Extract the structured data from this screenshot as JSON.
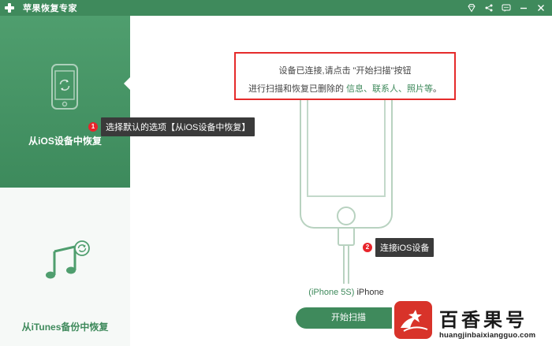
{
  "app": {
    "title": "苹果恢复专家"
  },
  "titlebar_icons": [
    "diamond-icon",
    "share-icon",
    "chat-icon",
    "minimize-icon",
    "close-icon"
  ],
  "sidebar": {
    "items": [
      {
        "label": "从iOS设备中恢复",
        "icon": "phone-refresh-icon",
        "selected": true
      },
      {
        "label": "从iTunes备份中恢复",
        "icon": "music-refresh-icon",
        "selected": false
      }
    ]
  },
  "callouts": [
    {
      "number": "1",
      "text": "选择默认的选项【从iOS设备中恢复】"
    },
    {
      "number": "2",
      "text": "连接iOS设备"
    }
  ],
  "notice": {
    "line1": "设备已连接,请点击 \"开始扫描\"按钮",
    "line2_prefix": "进行扫描和恢复已删除的 ",
    "line2_highlight": "信息、联系人、照片等",
    "line2_suffix": "。"
  },
  "device": {
    "model": "(iPhone 5S)",
    "type": " iPhone"
  },
  "start_button": {
    "label": "开始扫描"
  },
  "watermark": {
    "brand": "百香果号",
    "url": "huangjinbaixiangguo.com"
  },
  "colors": {
    "primary_green": "#3f8a5c",
    "callout_badge_red": "#e8242b",
    "notice_border_red": "#e52b2b",
    "tooltip_bg": "#3a3a3a"
  }
}
